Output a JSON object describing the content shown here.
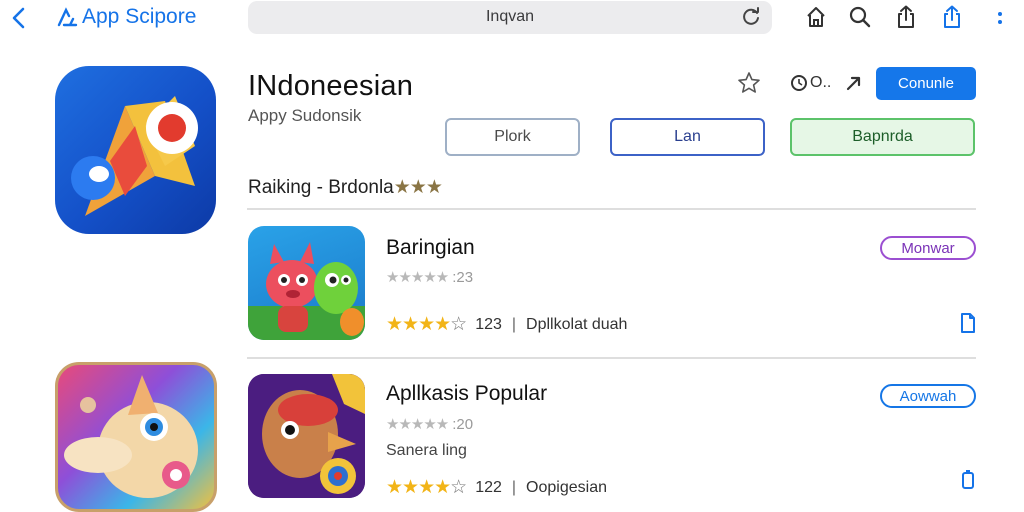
{
  "browser": {
    "brand_label": "App Scipore",
    "url_text": "Inqvan"
  },
  "app": {
    "title": "INdoneesian",
    "subtitle": "Appy Sudonsik",
    "primary_button": "Conunle",
    "pills": [
      "Plork",
      "Lan",
      "Bapnrda"
    ],
    "ranking_label": "Raiking - Brdonla",
    "ranking_stars": "★★★",
    "control_label": "O.."
  },
  "items": [
    {
      "title": "Baringian",
      "gray_stars": "★★★★★",
      "gray_count": ":23",
      "stars": "★★★★",
      "empty_star": "☆",
      "count": "123",
      "developer": "Dpllkolat duah",
      "tag": "Monwar"
    },
    {
      "title": "Apllkasis Popular",
      "gray_stars": "★★★★★",
      "gray_count": ":20",
      "caption": "Sanera ling",
      "stars": "★★★★",
      "empty_star": "☆",
      "count": "122",
      "developer": "Oopigesian",
      "tag": "Aowwah"
    }
  ],
  "colors": {
    "accent": "#1577ea",
    "tag_purple": "#9b4fd1",
    "pill_green": "#5cc36a",
    "star_gold": "#f2b417"
  },
  "icons": [
    "back-icon",
    "app-store-icon",
    "reload-icon",
    "home-icon",
    "search-icon",
    "share-icon",
    "upload-icon",
    "more-icon",
    "star-outline-icon",
    "clock-icon",
    "forward-icon",
    "document-icon"
  ]
}
